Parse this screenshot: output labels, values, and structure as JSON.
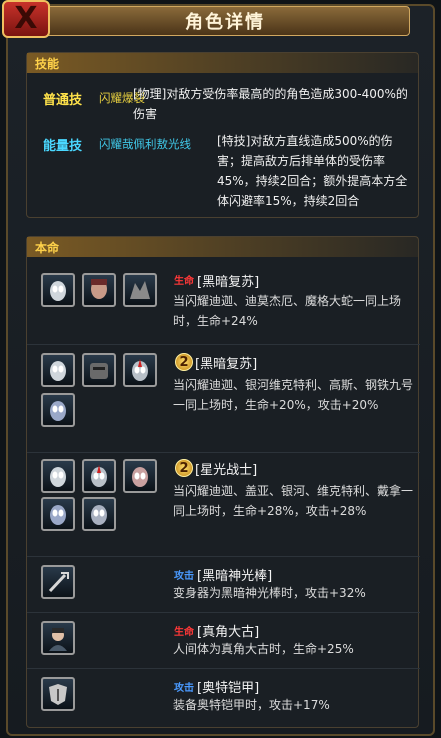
{
  "header": {
    "title": "角色详情",
    "close_label": "X"
  },
  "skills": {
    "section_label": "技能",
    "items": [
      {
        "type": "普通技",
        "name": "闪耀爆裂",
        "desc": "[物理]对敌方受伤率最高的的角色造成300-400%的伤害"
      },
      {
        "type": "能量技",
        "name": "闪耀哉佩利敖光线",
        "desc": "[特技]对敌方直线造成500%的伤害；提高敌方后排单体的受伤率45%，持续2回合；额外提高本方全体闪避率15%，持续2回合"
      }
    ]
  },
  "fate": {
    "section_label": "本命",
    "items": [
      {
        "tag": "生命",
        "name": "[黑暗复苏]",
        "desc": "当闪耀迪迦、迪莫杰厄、魔格大蛇一同上场时，生命+24%"
      },
      {
        "badge": "2",
        "name": "[黑暗复苏]",
        "desc": "当闪耀迪迦、银河维克特利、高斯、钢铁九号一同上场时，生命+20%，攻击+20%"
      },
      {
        "badge": "2",
        "name": "[星光战士]",
        "desc": "当闪耀迪迦、盖亚、银河、维克特利、戴拿一同上场时，生命+28%，攻击+28%"
      },
      {
        "tag": "攻击",
        "name": "[黑暗神光棒]",
        "desc": "变身器为黑暗神光棒时，攻击+32%"
      },
      {
        "tag": "生命",
        "name": "[真角大古]",
        "desc": "人间体为真角大古时，生命+25%"
      },
      {
        "tag": "攻击",
        "name": "[奥特铠甲]",
        "desc": "装备奥特铠甲时，攻击+17%"
      }
    ]
  }
}
